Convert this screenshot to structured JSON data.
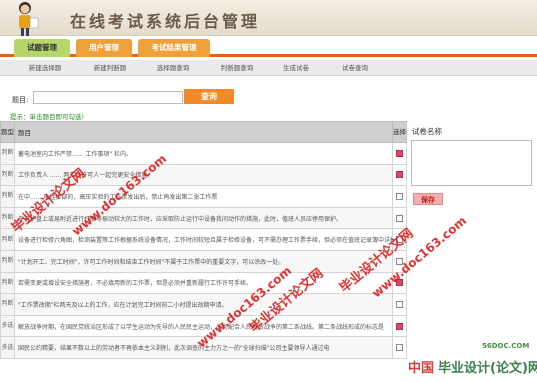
{
  "header": {
    "title": "在线考试系统后台管理"
  },
  "nav": {
    "tabs": [
      {
        "label": "试题管理",
        "active": true
      },
      {
        "label": "用户管理",
        "active": false
      },
      {
        "label": "考试结果管理",
        "active": false
      }
    ]
  },
  "subnav": {
    "items": [
      "新建选择题",
      "新建判断题",
      "选择题查询",
      "判断题查询",
      "生成试卷",
      "试卷查询"
    ]
  },
  "form": {
    "title_label": "题目:",
    "search_button": "查询",
    "tip": "提示：单击题目即可勾选!"
  },
  "table": {
    "headers": {
      "type": "题型",
      "question": "题目",
      "select": "选择"
    },
    "rows": [
      {
        "type": "判断",
        "text": "蓄电池室内工作严禁...... 工作事项\" 栏内。",
        "checked": true
      },
      {
        "type": "判断",
        "text": "工作负责人 ...... 两工作许可人一起完更安全措施。",
        "checked": true
      },
      {
        "type": "判断",
        "text": "在中...... 电连接部的，高压实验的工作票发出后，禁止再发出第二张工作票",
        "checked": false
      },
      {
        "type": "判断",
        "text": "在进护盘上或易附近进行打眼等振动较大的工作时，应采取防止运行中设备我间动作的措施，此时，值班人员应停用保护。",
        "checked": false
      },
      {
        "type": "判断",
        "text": "设备进行检修六角图，检测装置等工作根据系统设备情况，工作时间较短且属于检修设备，可不需办理工作票手续，但必须在值班记录簿中详细注明。",
        "checked": false
      },
      {
        "type": "判断",
        "text": "\"计划开工、完工时间\"，许可工作时间和结束工作时间\"不属于工作票中的重要文字，可以涂改一处。",
        "checked": false
      },
      {
        "type": "判断",
        "text": "若需变更或增设安全措施者，不必填用新的工作票，但是必须并重新履行工作许可手续。",
        "checked": true
      },
      {
        "type": "判断",
        "text": "\"工作票改期\"栏两天及以上的工作，应在计划完工时间前二小时提出改期申请。",
        "checked": false
      },
      {
        "type": "多选",
        "text": "解放战争时期，在国民党统治区形成了以学生运动为先导的人民民主运动，成为配合人民解放战争的第二条战线。第二条战线形成的标志是",
        "checked": true
      },
      {
        "type": "多选",
        "text": "国民公约精要，结果不数以上的劳动者不再依本主义剥削，此次调查的主力方之一的\"全球扫描\"公司主要领导人通过电",
        "checked": false
      }
    ]
  },
  "side": {
    "paper_name_label": "试卷名称",
    "save_button": "保存"
  },
  "watermarks": [
    "毕业设计论文网",
    "www.doc163.com",
    "毕业设计论文网",
    "www.doc163.com",
    "毕业设计论文网",
    "www.doc163.com",
    "56DOC.COM",
    "毕业设计(论文)网",
    "中国"
  ],
  "colors": {
    "accent": "#e8630e",
    "check_on": "#d84a6a",
    "watermark": "#e01010"
  }
}
